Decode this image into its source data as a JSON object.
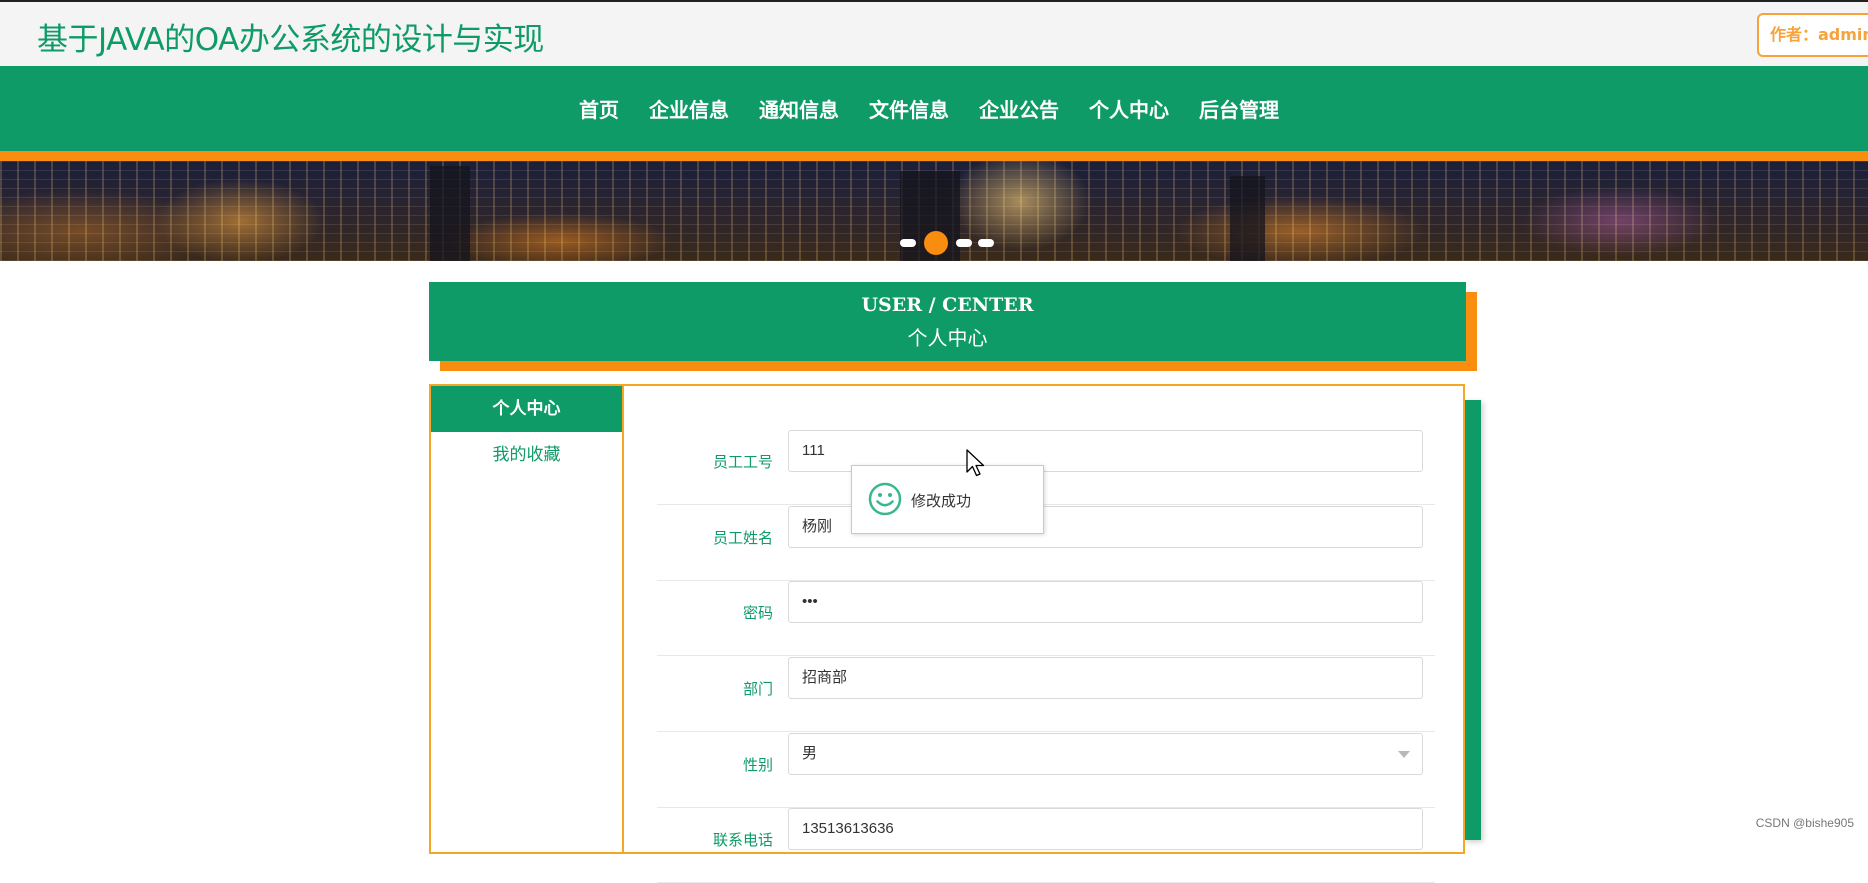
{
  "header": {
    "site_title": "基于JAVA的OA办公系统的设计与实现",
    "author_label": "作者：admin"
  },
  "nav": {
    "items": [
      "首页",
      "企业信息",
      "通知信息",
      "文件信息",
      "企业公告",
      "个人中心",
      "后台管理"
    ]
  },
  "banner": {
    "slide_count": 4,
    "active_slide": 2
  },
  "user_center": {
    "title_en": "USER / CENTER",
    "title_cn": "个人中心"
  },
  "side_menu": {
    "items": [
      {
        "label": "个人中心",
        "active": true
      },
      {
        "label": "我的收藏",
        "active": false
      }
    ]
  },
  "form": {
    "employee_id": {
      "label": "员工工号",
      "value": "111"
    },
    "employee_name": {
      "label": "员工姓名",
      "value": "杨刚"
    },
    "password": {
      "label": "密码",
      "value": "•••"
    },
    "department": {
      "label": "部门",
      "value": "招商部"
    },
    "gender": {
      "label": "性别",
      "value": "男"
    },
    "phone": {
      "label": "联系电话",
      "value": "13513613636"
    }
  },
  "toast": {
    "message": "修改成功",
    "icon": "smile-icon"
  },
  "watermark": "CSDN @bishe905",
  "colors": {
    "primary_green": "#0e9b68",
    "accent_orange": "#f98d10",
    "border_orange": "#f5a623"
  }
}
